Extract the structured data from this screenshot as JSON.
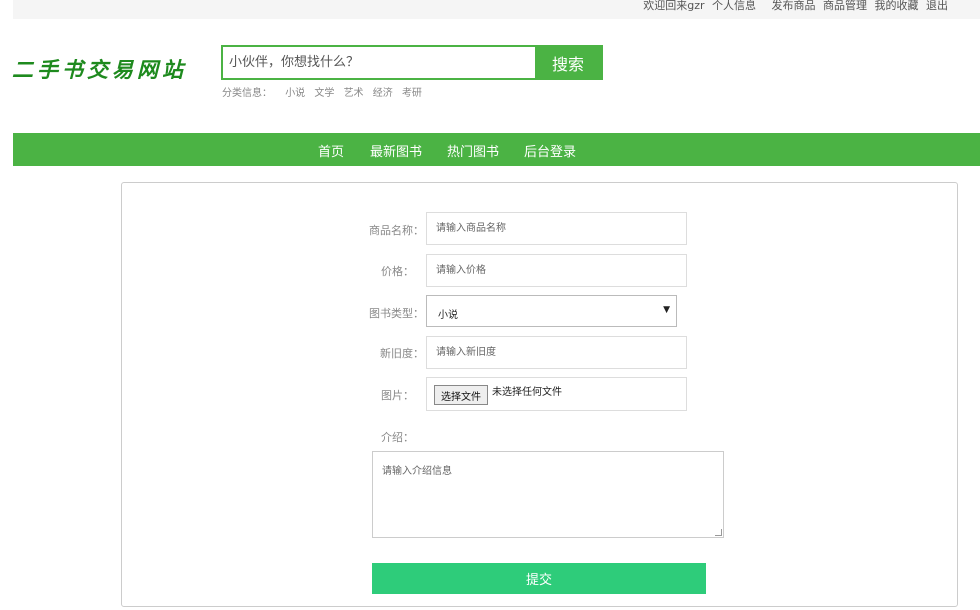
{
  "topbar": {
    "welcome": "欢迎回来gzr",
    "links": [
      "个人信息",
      "发布商品",
      "商品管理",
      "我的收藏",
      "退出"
    ]
  },
  "logo": "二手书交易网站",
  "search": {
    "placeholder": "小伙伴，你想找什么？",
    "button_label": "搜索"
  },
  "categories": {
    "label": "分类信息：",
    "items": [
      "小说",
      "文学",
      "艺术",
      "经济",
      "考研"
    ]
  },
  "nav": {
    "items": [
      "首页",
      "最新图书",
      "热门图书",
      "后台登录"
    ]
  },
  "form": {
    "name_label": "商品名称：",
    "name_placeholder": "请输入商品名称",
    "price_label": "价格：",
    "price_placeholder": "请输入价格",
    "type_label": "图书类型：",
    "type_value": "小说",
    "condition_label": "新旧度：",
    "condition_placeholder": "请输入新旧度",
    "image_label": "图片：",
    "file_button": "选择文件",
    "file_status": "未选择任何文件",
    "intro_label": "介绍：",
    "intro_placeholder": "请输入介绍信息",
    "submit_label": "提交"
  }
}
